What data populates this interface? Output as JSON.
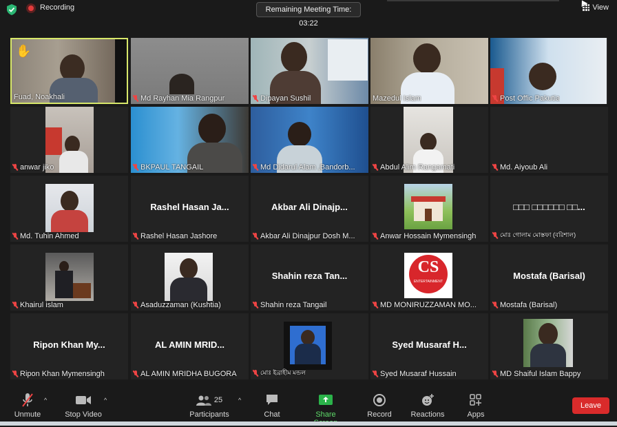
{
  "topbar": {
    "recording_label": "Recording",
    "timer_text": "Remaining Meeting Time: 03:22",
    "view_label": "View"
  },
  "tiles": [
    {
      "label": "Fuad, Noakhali",
      "muted": false,
      "active": true,
      "hand": true,
      "center": ""
    },
    {
      "label": "Md Rayhan Mia Rangpur",
      "muted": true,
      "active": false,
      "hand": false,
      "center": ""
    },
    {
      "label": "Dipayan Sushil",
      "muted": true,
      "active": false,
      "hand": false,
      "center": ""
    },
    {
      "label": "Mazedul Islam",
      "muted": false,
      "active": false,
      "hand": false,
      "center": ""
    },
    {
      "label": "Post Offic Pakutia",
      "muted": true,
      "active": false,
      "hand": false,
      "center": ""
    },
    {
      "label": "anwar jiko",
      "muted": true,
      "active": false,
      "hand": false,
      "center": ""
    },
    {
      "label": "BKPAUL TANGAIL",
      "muted": true,
      "active": false,
      "hand": false,
      "center": ""
    },
    {
      "label": "Md Didarul Alam ,Bandorb...",
      "muted": true,
      "active": false,
      "hand": false,
      "center": ""
    },
    {
      "label": "Abdul Alim Rangamati",
      "muted": true,
      "active": false,
      "hand": false,
      "center": ""
    },
    {
      "label": "Md. Aiyoub Ali",
      "muted": true,
      "active": false,
      "hand": false,
      "center": ""
    },
    {
      "label": "Md. Tuhin Ahmed",
      "muted": true,
      "active": false,
      "hand": false,
      "center": ""
    },
    {
      "label": "Rashel Hasan Jashore",
      "muted": true,
      "active": false,
      "hand": false,
      "center": "Rashel Hasan Ja..."
    },
    {
      "label": "Akbar Ali Dinajpur Dosh M...",
      "muted": true,
      "active": false,
      "hand": false,
      "center": "Akbar Ali Dinajp..."
    },
    {
      "label": "Anwar Hossain Mymensingh",
      "muted": true,
      "active": false,
      "hand": false,
      "center": ""
    },
    {
      "label": "মোঃ গোলাম মোস্তফা (বরিশাল)",
      "muted": true,
      "active": false,
      "hand": false,
      "center": "□□□ □□□□□□ □□..."
    },
    {
      "label": "Khairul islam",
      "muted": true,
      "active": false,
      "hand": false,
      "center": ""
    },
    {
      "label": "Asaduzzaman (Kushtia)",
      "muted": true,
      "active": false,
      "hand": false,
      "center": ""
    },
    {
      "label": "Shahin reza Tangail",
      "muted": true,
      "active": false,
      "hand": false,
      "center": "Shahin reza Tan..."
    },
    {
      "label": "MD MONIRUZZAMAN MO...",
      "muted": true,
      "active": false,
      "hand": false,
      "center": ""
    },
    {
      "label": "Mostafa (Barisal)",
      "muted": true,
      "active": false,
      "hand": false,
      "center": "Mostafa (Barisal)"
    },
    {
      "label": "Ripon Khan Mymensingh",
      "muted": true,
      "active": false,
      "hand": false,
      "center": "Ripon Khan My..."
    },
    {
      "label": "AL AMIN MRIDHA BUGORA",
      "muted": true,
      "active": false,
      "hand": false,
      "center": "AL AMIN MRID..."
    },
    {
      "label": "মোঃ ইব্রাহীম মন্ডল",
      "muted": true,
      "active": false,
      "hand": false,
      "center": ""
    },
    {
      "label": "Syed Musaraf Hussain",
      "muted": true,
      "active": false,
      "hand": false,
      "center": "Syed Musaraf H..."
    },
    {
      "label": "MD Shaiful Islam Bappy",
      "muted": true,
      "active": false,
      "hand": false,
      "center": ""
    }
  ],
  "logo_cs": {
    "text": "CS",
    "sub": "ENTERTAINMENT"
  },
  "toolbar": {
    "unmute": "Unmute",
    "stop_video": "Stop Video",
    "participants": "Participants",
    "participants_count": "25",
    "chat": "Chat",
    "share_screen": "Share Screen",
    "record": "Record",
    "reactions": "Reactions",
    "apps": "Apps",
    "leave": "Leave"
  },
  "colors": {
    "active_border": "#d8e86a",
    "leave_bg": "#d92b2b",
    "share_green": "#5fdc6a",
    "muted_red": "#e44444"
  }
}
